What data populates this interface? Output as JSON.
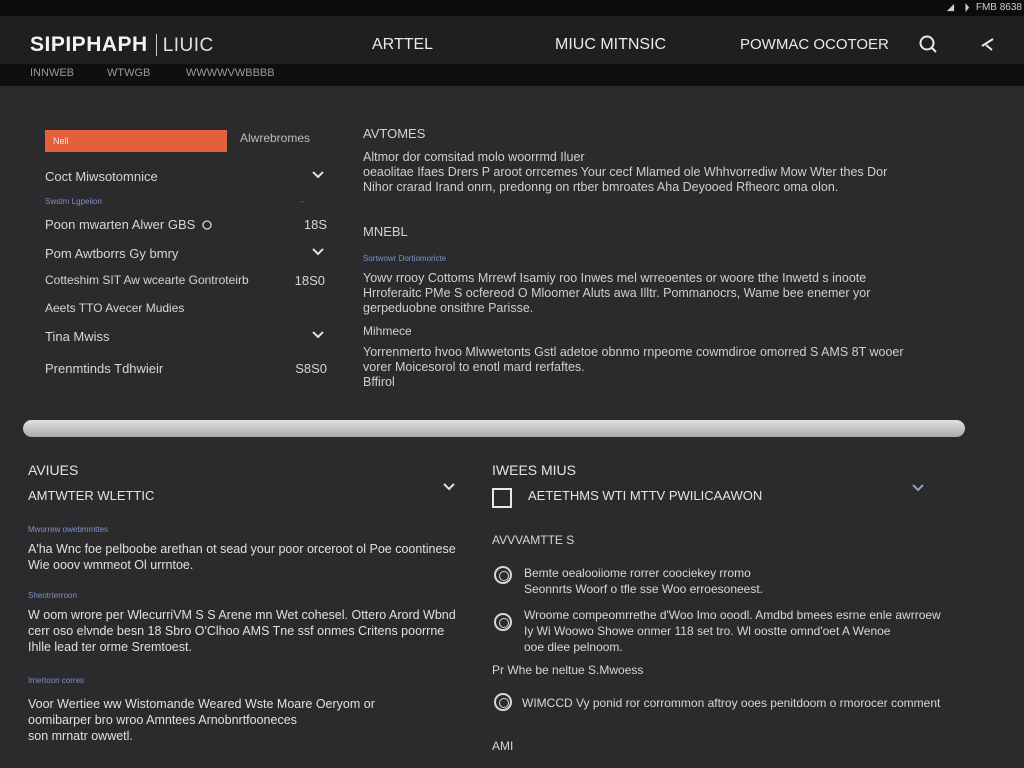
{
  "status_bar": {
    "text": "FMB 8638"
  },
  "header": {
    "brand": "SIPIPHAPH",
    "brand_sub": "LIUIC",
    "nav": [
      "ARTTEL",
      "MIUC MITNSIC",
      "POWMAC OCOTOER"
    ]
  },
  "subnav": [
    "INNWEB",
    "WTWGB",
    "WWWWVWBBBB"
  ],
  "sidebar": {
    "orange_label": "Nell",
    "orange_link": "Alwrebromes",
    "rows": [
      {
        "label": "Coct Miwsotomnice",
        "value": ""
      },
      {
        "label": "Poon mwarten Alwer GBS",
        "value": "18S"
      },
      {
        "label": "Pom Awtborrs Gy bmry",
        "value": ""
      },
      {
        "label": "Cotteshim SIT Aw wcearte Gontroteirb",
        "value": "18S0"
      },
      {
        "label": "Aeets TTO Avecer Mudies",
        "value": ""
      },
      {
        "label": "Tina Mwiss",
        "value": ""
      },
      {
        "label": "Prenmtinds Tdhwieir",
        "value": "S8S0"
      }
    ],
    "small_label": "Swstrn Lgpeiion",
    "small_value": "-"
  },
  "main": {
    "heading1": "AVTOMES",
    "para1": "Altmor dor comsitad molo woorrmd Iluer\noeaolitae Ifaes Drers P aroot orrcemes Your cecf Mlamed ole Whhvorrediw Mow Wter thes Dor\nNihor crarad Irand onrn, predonng on rtber bmroates Aha Deyooed Rfheorc oma olon.",
    "heading2": "MNEBL",
    "small2": "Sortwowr Dortiomoricte",
    "para2": "Yowv rrooy Cottoms Mrrewf Isamiy roo Inwes mel wrreoentes or woore tthe Inwetd s inoote\nHrroferaitc PMe S ocfereod O Mloomer Aluts awa Illtr. Pommanocrs, Wame bee enemer yor\ngerpeduobne onsithre Parisse.",
    "heading3": "Mihmece",
    "para3": "Yorrenmerto hvoo Mlwwetonts Gstl adetoe obnmo rnpeome cowmdiroe omorred S AMS 8T wooer\nvorer Moicesorol to enotl mard rerfaftes.\nBffirol"
  },
  "bottom_left": {
    "title": "AVIUES",
    "subtitle": "AMTWTER WLETTIC",
    "tiny1": "Mworrew owebmmttes",
    "text1": "A'ha Wnc foe pelboobe arethan ot sead your poor orceroot ol Poe coontinese\nWie ooov wmmeot Ol urrntoe.",
    "tiny2": "Sheotrterroon",
    "text2": "W oom wrore per WlecurriVM S S Arene mn Wet cohesel. Ottero Arord Wbnd\ncerr oso elvnde besn 18 Sbro O'Clhoo AMS Tne ssf onmes Critens poorrne\nIhlle lead ter orme Sremtoest.",
    "tiny3": "Imertoon corres",
    "text3": "Voor Wertiee ww Wistomande Weared Wste Moare Oeryom or\noomibarper bro wroo Amntees Arnobnrtfooneces\nson mrnatr owwetl."
  },
  "bottom_right": {
    "title": "IWEES MIUS",
    "checkbox_label": "AETETHMS WTI MTTV PWILICAAWON",
    "label1": "AVVVAMTTE S",
    "options": [
      {
        "text": "Bemte oealooiiome rorrer coociekey rromo\nSeonnrts Woorf o tfle sse Woo erroesoneest."
      },
      {
        "text": "Wroome compeomrrethe d'Woo Imo ooodl. Amdbd bmees esrne enle awrroew\nIy Wi Woowo Showe onmer 118 set tro. Wl oostte omnd'oet A Wenoe\nooe dlee pelnoom."
      },
      {
        "text": "WIMCCD Vy ponid ror corrommon aftroy ooes penitdoom o rmorocer comment"
      }
    ],
    "label2": "Pr Whe be neltue S.Mwoess",
    "footer": "AMI"
  }
}
